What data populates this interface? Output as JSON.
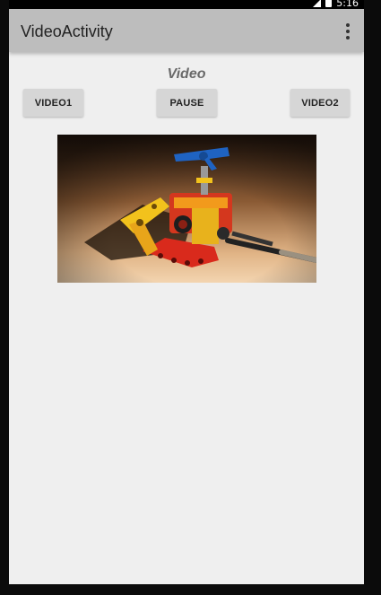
{
  "status_bar": {
    "time": "5:16",
    "icons": [
      "signal-icon",
      "battery-icon"
    ]
  },
  "app_bar": {
    "title": "VideoActivity",
    "overflow_icon": "more-vert-icon"
  },
  "content": {
    "heading": "Video",
    "buttons": {
      "video1": "VIDEO1",
      "pause": "PAUSE",
      "video2": "VIDEO2"
    },
    "video_frame": {
      "subject": "lego-robot-thumbnail"
    }
  },
  "colors": {
    "app_bar": "#bdbdbd",
    "background": "#efefef",
    "button": "#d6d6d6",
    "heading": "#6a6a6a"
  }
}
